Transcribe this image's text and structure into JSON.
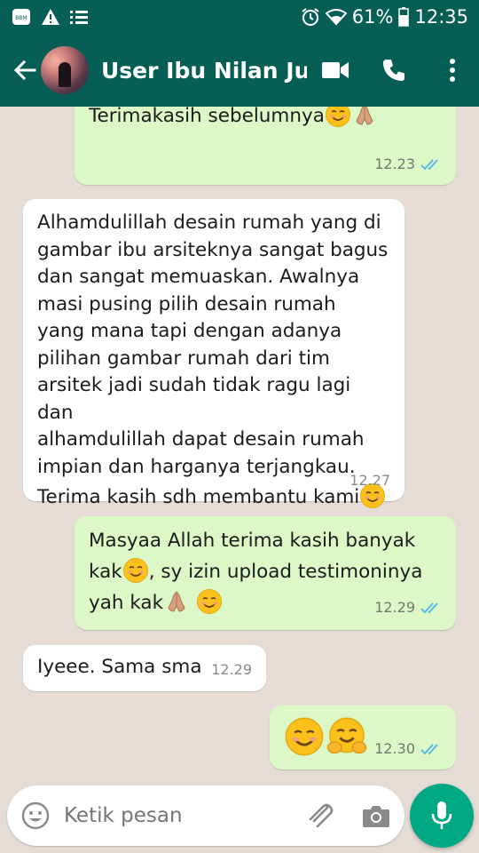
{
  "status_bar": {
    "battery_percent": "61%",
    "time": "12:35"
  },
  "header": {
    "contact_name": "User Ibu Nilan Ju..."
  },
  "messages": [
    {
      "direction": "out",
      "text": "Terimakasih sebelumnya",
      "time": "12.23",
      "status": "read"
    },
    {
      "direction": "in",
      "text": "Alhamdulillah desain rumah yang di\ngambar ibu arsiteknya sangat bagus\ndan sangat memuaskan. Awalnya\nmasi pusing pilih desain rumah\nyang mana tapi dengan adanya\npilihan gambar rumah dari tim\narsitek jadi sudah tidak ragu lagi dan\nalhamdulillah dapat desain rumah\nimpian dan harganya terjangkau.",
      "text2": "Terima kasih sdh membantu kami",
      "time": "12.27"
    },
    {
      "direction": "out",
      "text_a": "Masyaa Allah terima kasih banyak",
      "text_b": "kak",
      "text_c": ", sy izin upload testimoninya",
      "text_d": "yah kak",
      "time": "12.29",
      "status": "read"
    },
    {
      "direction": "in",
      "text": "Iyeee. Sama sma",
      "time": "12.29"
    },
    {
      "direction": "out",
      "text": "",
      "time": "12.30",
      "status": "read"
    }
  ],
  "input": {
    "placeholder": "Ketik pesan"
  },
  "colors": {
    "header": "#075e54",
    "chat_background": "#e5ddd5",
    "outgoing_bubble": "#dcf8c6",
    "incoming_bubble": "#ffffff",
    "read_ticks": "#4fb6ec",
    "mic_button": "#00a884"
  },
  "icons": {
    "status_left": [
      "bbm-icon",
      "warning-icon",
      "list-icon"
    ],
    "status_right": [
      "alarm-icon",
      "wifi-icon",
      "battery-icon"
    ],
    "header": [
      "back-arrow-icon",
      "video-call-icon",
      "phone-icon",
      "more-vert-icon"
    ],
    "input": [
      "emoji-icon",
      "attach-icon",
      "camera-icon",
      "mic-icon"
    ]
  }
}
